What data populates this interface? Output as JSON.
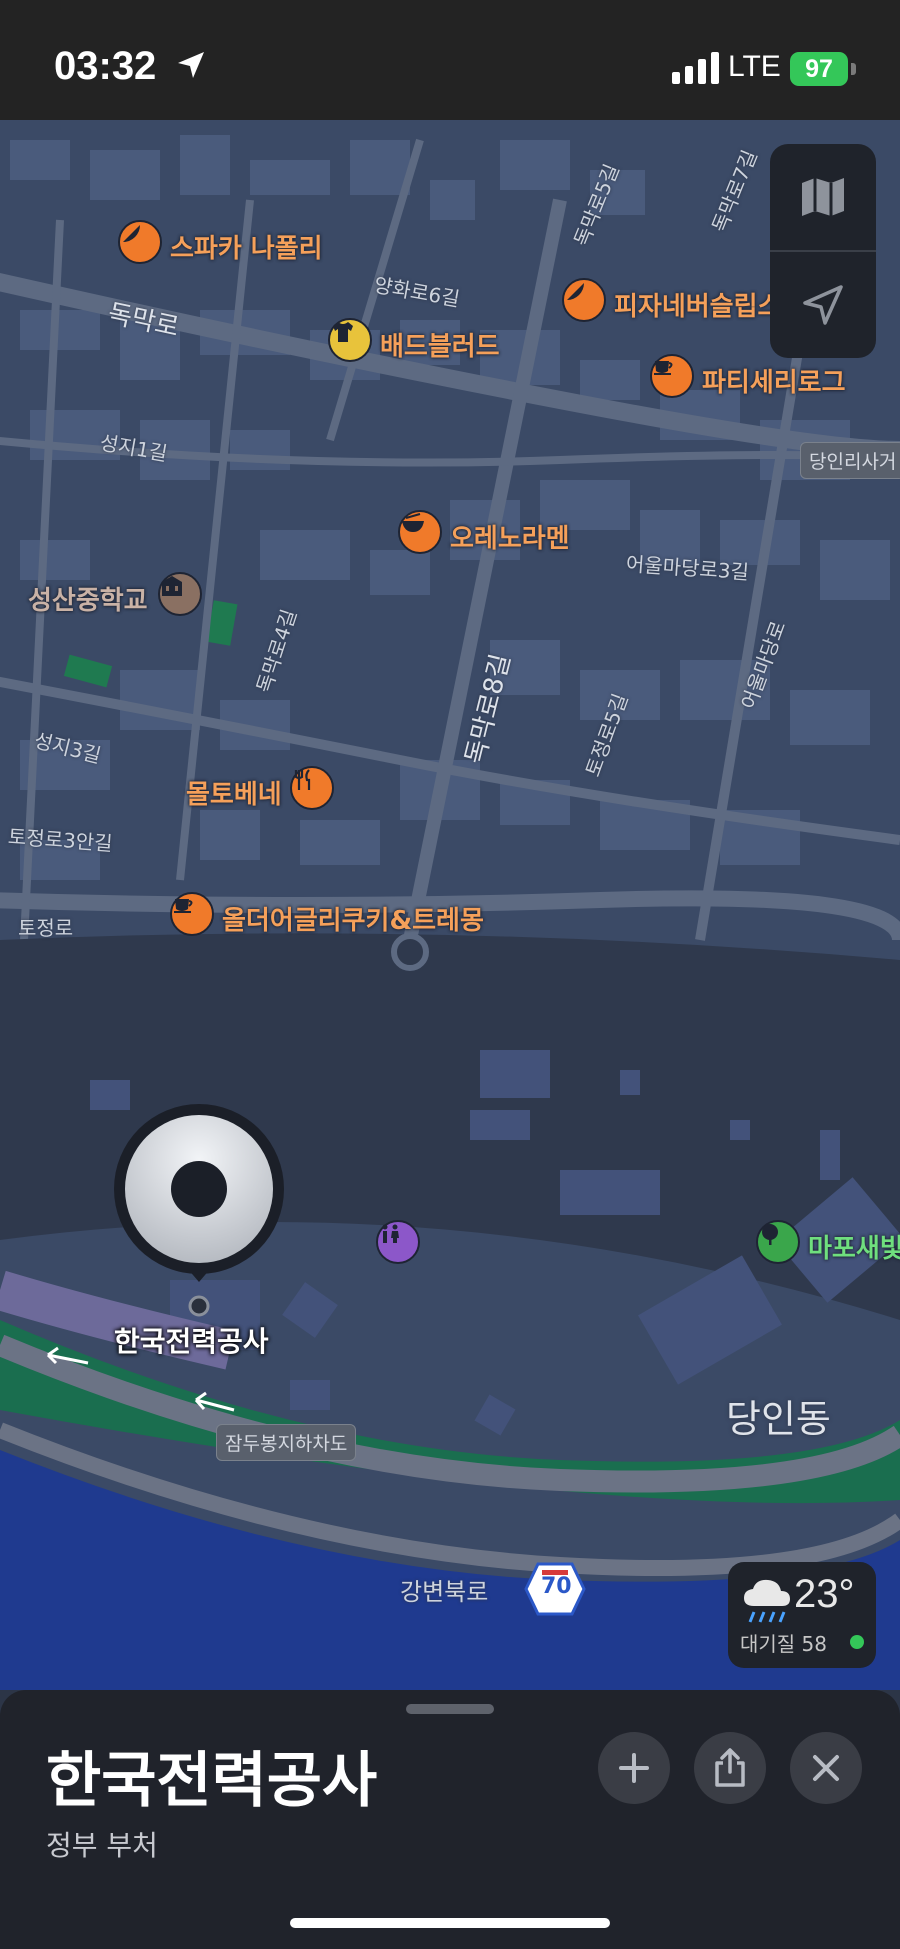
{
  "status_bar": {
    "time": "03:32",
    "network": "LTE",
    "battery": "97"
  },
  "map": {
    "pois": [
      {
        "id": "spacca",
        "name": "스파카 나폴리",
        "icon": "pizza-icon",
        "color": "#f07a2a"
      },
      {
        "id": "pizzane",
        "name": "피자네버슬립스",
        "icon": "pizza-icon",
        "color": "#f07a2a"
      },
      {
        "id": "badblood",
        "name": "배드블러드",
        "icon": "tshirt-icon",
        "color": "#e8c33b"
      },
      {
        "id": "patisserie",
        "name": "파티세리로그",
        "icon": "coffee-icon",
        "color": "#f07a2a"
      },
      {
        "id": "orenoramen",
        "name": "오레노라멘",
        "icon": "ramen-bowl-icon",
        "color": "#f07a2a"
      },
      {
        "id": "school",
        "name": "성산중학교",
        "icon": "school-icon",
        "color": "#8a7062"
      },
      {
        "id": "moltobene",
        "name": "몰토베네",
        "icon": "fork-knife-icon",
        "color": "#f07a2a"
      },
      {
        "id": "olderguri",
        "name": "올더어글리쿠키&트레몽",
        "icon": "coffee-icon",
        "color": "#f07a2a"
      },
      {
        "id": "restroom",
        "name": "",
        "icon": "restroom-icon",
        "color": "#8c57c9"
      },
      {
        "id": "park",
        "name": "마포새빛",
        "icon": "tree-icon",
        "color": "#3aa64b"
      }
    ],
    "roads": {
      "dongmak": "독막로",
      "yanghwa6": "양화로6길",
      "dongmak5": "독막로5길",
      "dongmak7": "독막로7길",
      "seongji1": "성지1길",
      "eoulmadang3": "어울마당로3길",
      "dongmak4": "독막로4길",
      "dongmak8": "독막로8길",
      "tojeong5": "토정로5길",
      "eoulmadang": "어울마당로",
      "seongji3": "성지3길",
      "tojeong3an": "토정로3안길",
      "tojeong": "토정로",
      "gangbyeon": "강변북로",
      "dangin_badge": "당인리사거",
      "jamdubong_badge": "잠두봉지하차도",
      "highway_number": "70"
    },
    "area_label": "당인동",
    "pin_label": "한국전력공사"
  },
  "controls": {
    "map_mode": "map-icon",
    "locate": "location-arrow-icon"
  },
  "weather": {
    "temp": "23°",
    "aqi_label": "대기질 58",
    "aqi_color": "#34c759"
  },
  "sheet": {
    "title": "한국전력공사",
    "subtitle": "정부 부처"
  }
}
